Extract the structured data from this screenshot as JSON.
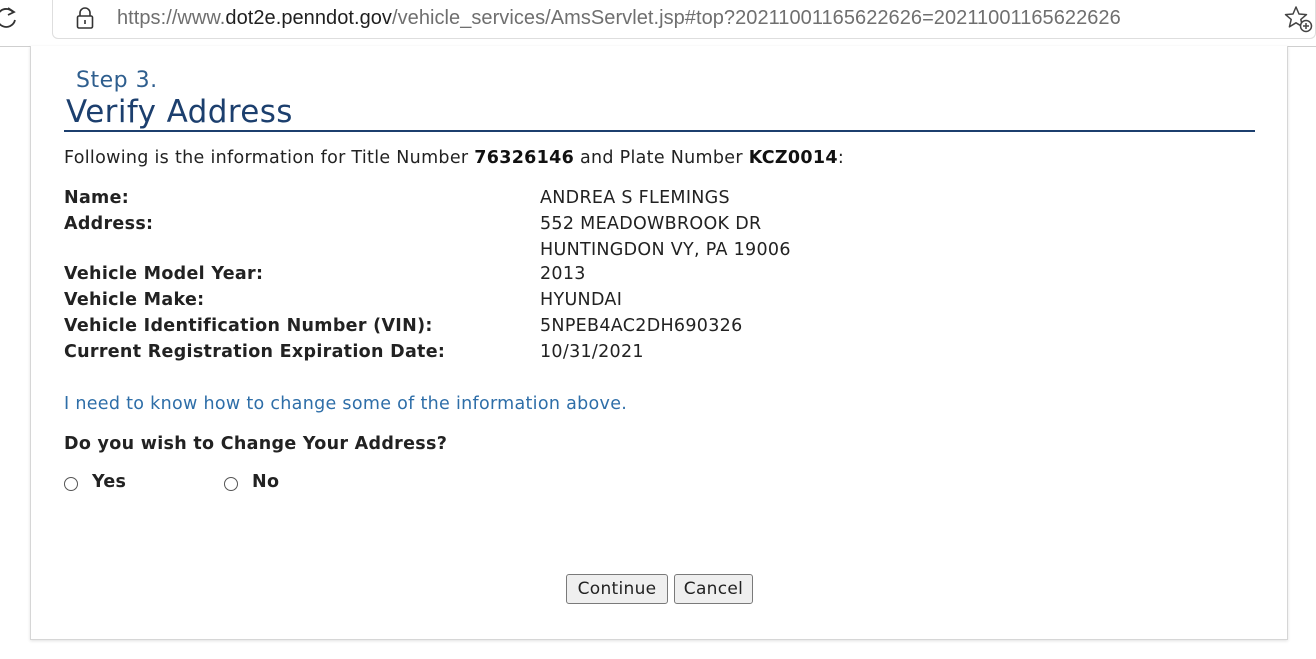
{
  "browser": {
    "url_prefix": "https://www.",
    "url_host": "dot2e.penndot.gov",
    "url_path": "/vehicle_services/AmsServlet.jsp#top?20211001165622626=20211001165622626",
    "icons": [
      "reload-icon",
      "lock-icon",
      "add-favorite-icon"
    ]
  },
  "step": {
    "label": "Step 3.",
    "title": "Verify Address"
  },
  "intro": {
    "prefix": "Following is the information for Title Number ",
    "title_number": "76326146",
    "middle": " and Plate Number ",
    "plate_number": "KCZ0014",
    "suffix": ":"
  },
  "info": {
    "name_label": "Name:",
    "name_value": "ANDREA S FLEMINGS",
    "address_label": "Address:",
    "address_line1": "552 MEADOWBROOK DR",
    "address_line2": "HUNTINGDON VY, PA 19006",
    "model_year_label": "Vehicle Model Year:",
    "model_year_value": "2013",
    "make_label": "Vehicle Make:",
    "make_value": "HYUNDAI",
    "vin_label": "Vehicle Identification Number (VIN):",
    "vin_value": "5NPEB4AC2DH690326",
    "expiration_label": "Current Registration Expiration Date:",
    "expiration_value": "10/31/2021"
  },
  "help_link": "I need to know how to change some of the information above.",
  "question": "Do you wish to Change Your Address?",
  "options": {
    "yes": "Yes",
    "no": "No"
  },
  "buttons": {
    "continue": "Continue",
    "cancel": "Cancel"
  },
  "colors": {
    "title": "#1c3f6e",
    "step": "#2e5e8e",
    "link": "#2e6ea8"
  }
}
